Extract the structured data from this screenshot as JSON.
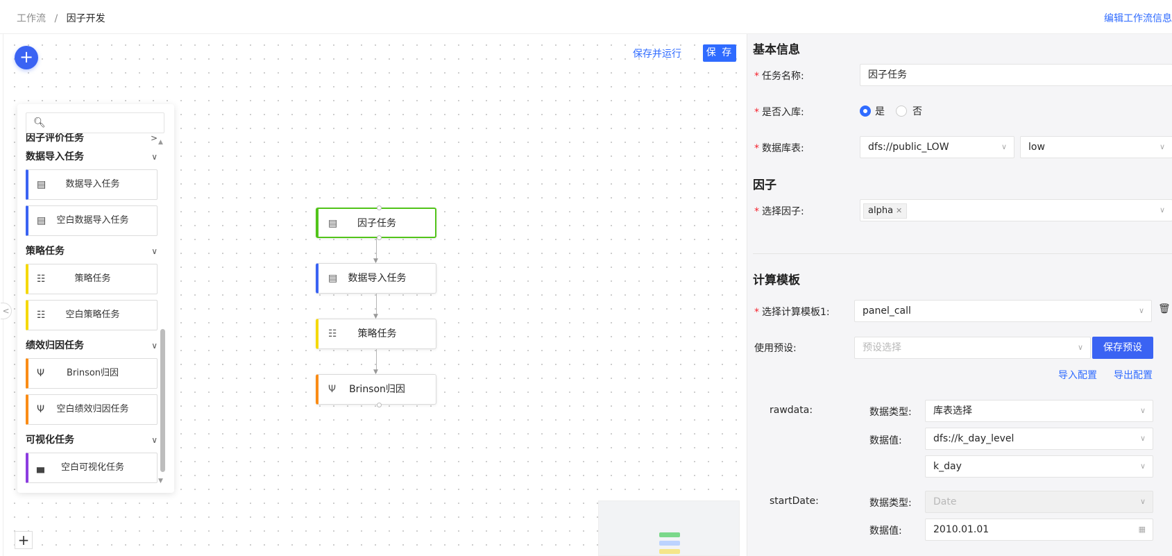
{
  "breadcrumb": {
    "root": "工作流",
    "separator": "/",
    "current": "因子开发"
  },
  "header": {
    "edit_link": "编辑工作流信息"
  },
  "toolbar": {
    "save_and_run": "保存并运行",
    "save": "保 存"
  },
  "palette": {
    "groups": [
      {
        "label": "因子评价任务",
        "chevron": ">"
      },
      {
        "label": "数据导入任务",
        "chevron": "∨",
        "items": [
          "数据导入任务",
          "空白数据导入任务"
        ],
        "color": "#3a63f3"
      },
      {
        "label": "策略任务",
        "chevron": "∨",
        "items": [
          "策略任务",
          "空白策略任务"
        ],
        "color": "#f5d90a"
      },
      {
        "label": "绩效归因任务",
        "chevron": "∨",
        "items": [
          "Brinson归因",
          "空白绩效归因任务"
        ],
        "color": "#fa8c16"
      },
      {
        "label": "可视化任务",
        "chevron": "∨",
        "items": [
          "空白可视化任务"
        ],
        "color": "#8c3ce0"
      }
    ]
  },
  "flow": {
    "nodes": [
      {
        "label": "因子任务",
        "color": "#52c41a",
        "icon": "factor-icon"
      },
      {
        "label": "数据导入任务",
        "color": "#3a63f3",
        "icon": "data-import-icon"
      },
      {
        "label": "策略任务",
        "color": "#f5d90a",
        "icon": "strategy-icon"
      },
      {
        "label": "Brinson归因",
        "color": "#fa8c16",
        "icon": "attribution-icon"
      }
    ]
  },
  "panel": {
    "basic": {
      "title": "基本信息",
      "task_name_label": "任务名称:",
      "task_name_value": "因子任务",
      "store_label": "是否入库:",
      "store_yes": "是",
      "store_no": "否",
      "store_selected": "是",
      "db_label": "数据库表:",
      "db_value": "dfs://public_LOW",
      "table_value": "low"
    },
    "factor": {
      "title": "因子",
      "select_label": "选择因子:",
      "tags": [
        "alpha"
      ]
    },
    "template": {
      "title": "计算模板",
      "select_label": "选择计算模板1:",
      "select_value": "panel_call",
      "preset_label": "使用预设:",
      "preset_placeholder": "预设选择",
      "save_preset": "保存预设",
      "import_config": "导入配置",
      "export_config": "导出配置",
      "params": [
        {
          "name": "rawdata:",
          "type_label": "数据类型:",
          "type_value": "库表选择",
          "value_label": "数据值:",
          "value_db": "dfs://k_day_level",
          "value_table": "k_day"
        },
        {
          "name": "startDate:",
          "type_label": "数据类型:",
          "type_value": "Date",
          "value_label": "数据值:",
          "value": "2010.01.01"
        }
      ]
    }
  }
}
